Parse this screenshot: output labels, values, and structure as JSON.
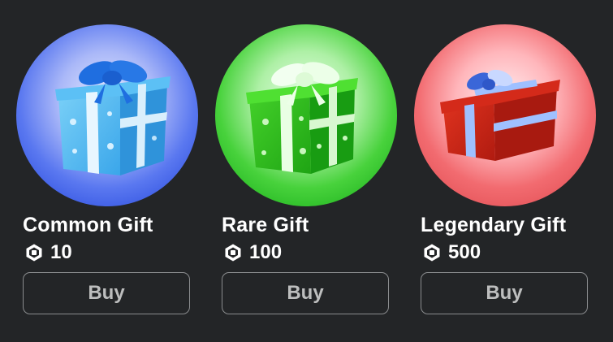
{
  "colors": {
    "background": "#232527",
    "common": "#4a7df0",
    "rare": "#3fcf3a",
    "legendary": "#f06a6a"
  },
  "items": [
    {
      "name": "Common Gift",
      "currency_icon": "robux-icon",
      "price": "10",
      "buy_label": "Buy"
    },
    {
      "name": "Rare Gift",
      "currency_icon": "robux-icon",
      "price": "100",
      "buy_label": "Buy"
    },
    {
      "name": "Legendary Gift",
      "currency_icon": "robux-icon",
      "price": "500",
      "buy_label": "Buy"
    }
  ]
}
